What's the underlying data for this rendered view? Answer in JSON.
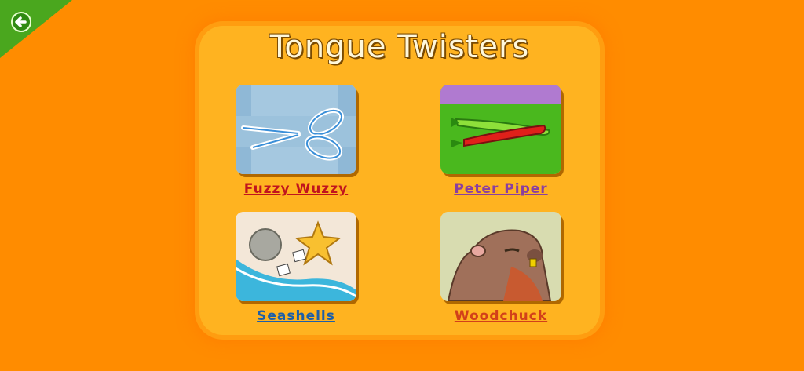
{
  "title": "Tongue Twisters",
  "nav": {
    "back_icon": "back-arrow-icon"
  },
  "colors": {
    "background": "#ff8c00",
    "panel": "#ffb320",
    "corner": "#4aa71e"
  },
  "items": [
    {
      "label": "Fuzzy Wuzzy",
      "color": "#c0141e",
      "icon": "scissors-icon"
    },
    {
      "label": "Peter Piper",
      "color": "#8a3fa0",
      "icon": "peppers-icon"
    },
    {
      "label": "Seashells",
      "color": "#1e5fa8",
      "icon": "seashells-icon"
    },
    {
      "label": "Woodchuck",
      "color": "#d2401a",
      "icon": "woodchuck-icon"
    }
  ]
}
